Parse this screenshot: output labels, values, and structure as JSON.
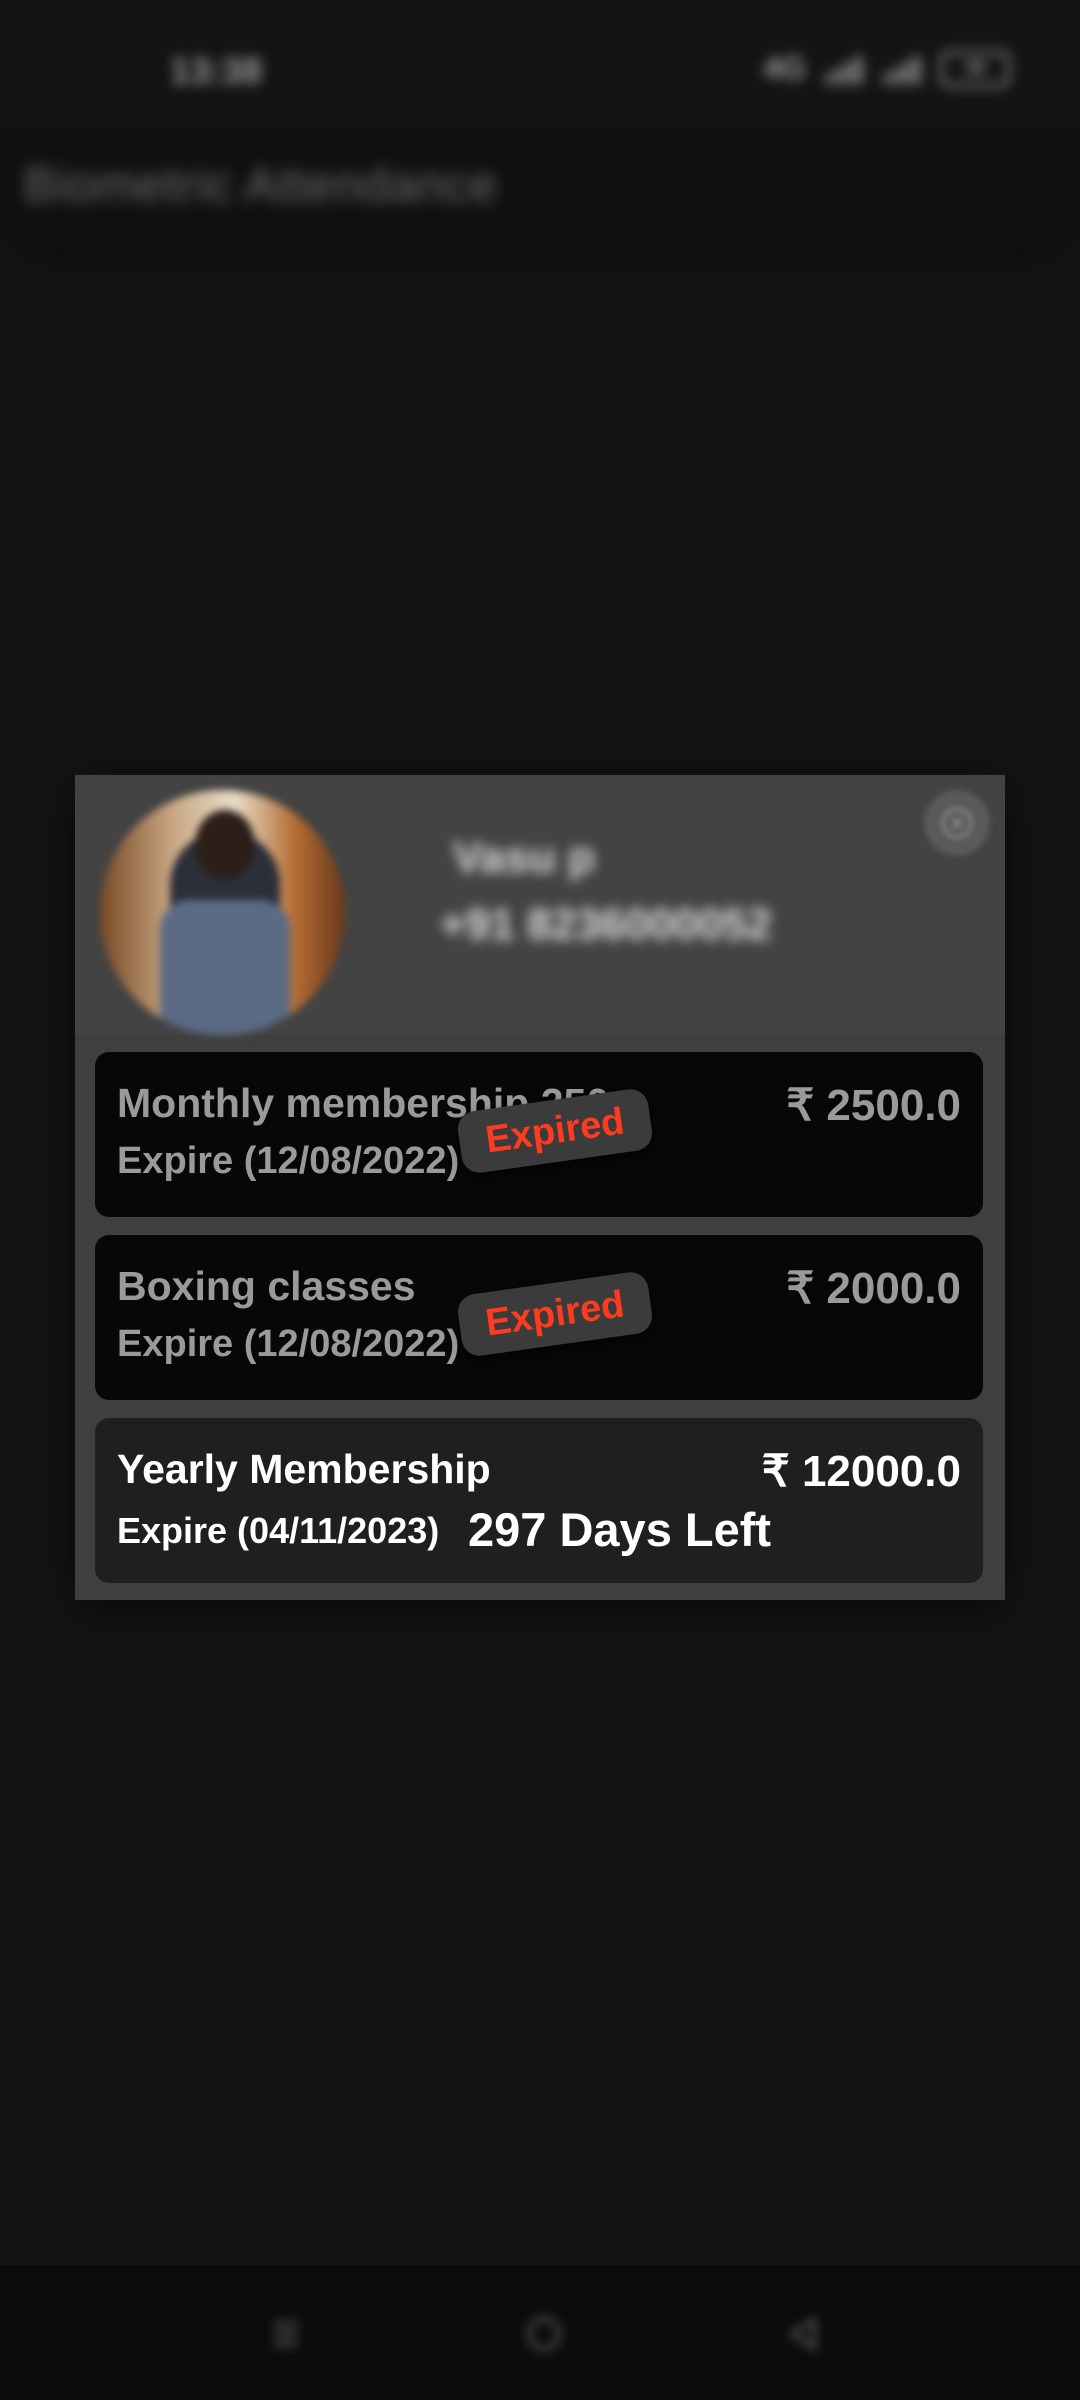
{
  "status_bar": {
    "time": "13:38",
    "network": "4G",
    "battery": "38"
  },
  "app_bar": {
    "title": "Biometric Attendance"
  },
  "dialog": {
    "user": {
      "name": "Vasu p",
      "phone": "+91 8236000052"
    },
    "plans": [
      {
        "name": "Monthly membership 250",
        "expire": "Expire (12/08/2022)",
        "price": "₹ 2500.0",
        "badge": "Expired"
      },
      {
        "name": "Boxing classes",
        "expire": "Expire (12/08/2022)",
        "price": "₹ 2000.0",
        "badge": "Expired"
      },
      {
        "name": "Yearly Membership",
        "expire": "Expire (04/11/2023)",
        "price": "₹ 12000.0",
        "days_left": "297 Days Left"
      }
    ]
  },
  "colors": {
    "expired": "#ff3b1f",
    "background": "#141414",
    "dialog": "#3f3f3f"
  },
  "icons": {
    "close": "close-icon",
    "nav_menu": "menu-icon",
    "nav_home": "home-icon",
    "nav_back": "back-icon"
  }
}
